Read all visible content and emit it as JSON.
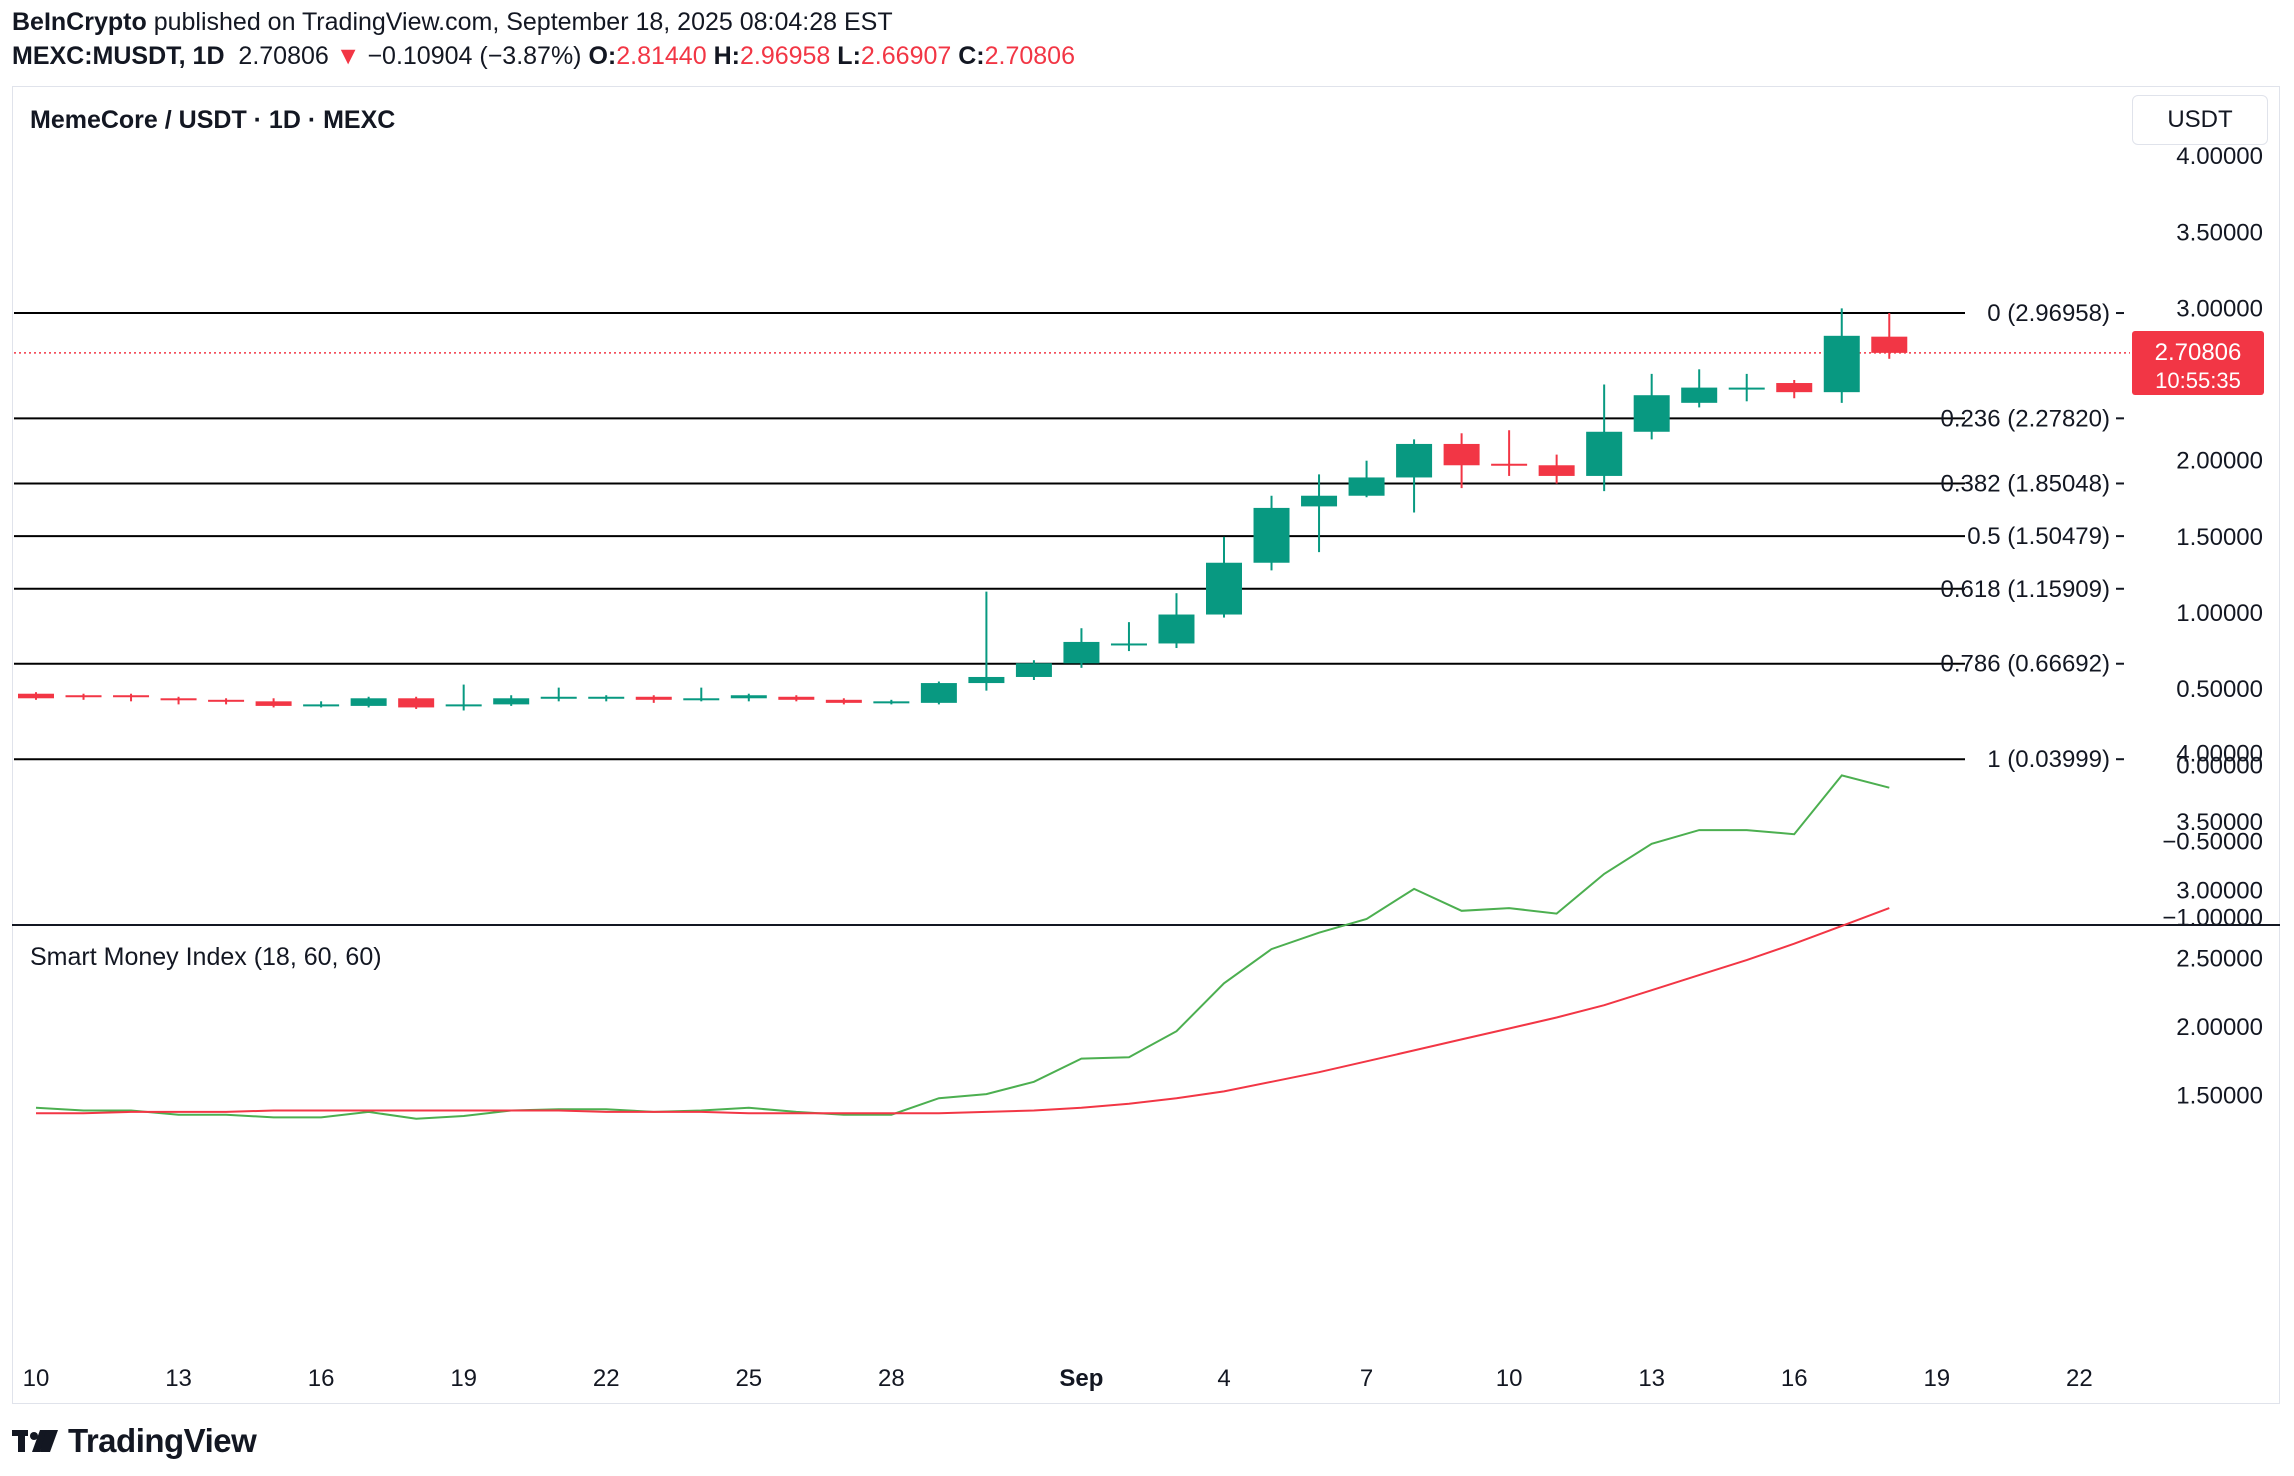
{
  "header": {
    "publisher": "BeInCrypto",
    "published_text": "published on TradingView.com, September 18, 2025 08:04:28 EST",
    "symbol": "MEXC:MUSDT, 1D",
    "last": "2.70806",
    "change_arrow": "▼",
    "change": "−0.10904 (−3.87%)",
    "o_label": "O:",
    "o": "2.81440",
    "h_label": "H:",
    "h": "2.96958",
    "l_label": "L:",
    "l": "2.66907",
    "c_label": "C:",
    "c": "2.70806"
  },
  "main_title": "MemeCore / USDT · 1D · MEXC",
  "currency_button": "USDT",
  "indicator_title": "Smart Money Index (18, 60, 60)",
  "price_label": {
    "value": "2.70806",
    "countdown": "10:55:35"
  },
  "logo_text": "TradingView",
  "colors": {
    "up": "#089981",
    "down": "#f23645",
    "smi_fast": "#4caf50",
    "smi_slow": "#f23645",
    "fib": "#000000"
  },
  "chart_data": [
    {
      "type": "candlestick",
      "title": "MemeCore / USDT · 1D · MEXC",
      "x_ticks": [
        "10",
        "13",
        "16",
        "19",
        "22",
        "25",
        "28",
        "Sep",
        "4",
        "7",
        "10",
        "13",
        "16",
        "19",
        "22"
      ],
      "y_ticks": [
        "4.00000",
        "3.50000",
        "3.00000",
        "2.00000",
        "1.50000",
        "1.00000",
        "0.50000",
        "0.00000",
        "−0.50000",
        "−1.00000"
      ],
      "ylim": [
        -1.0,
        4.0
      ],
      "fib_levels": [
        {
          "ratio": "0",
          "value": 2.96958,
          "label": "0 (2.96958)"
        },
        {
          "ratio": "0.236",
          "value": 2.2782,
          "label": "0.236 (2.27820)"
        },
        {
          "ratio": "0.382",
          "value": 1.85048,
          "label": "0.382 (1.85048)"
        },
        {
          "ratio": "0.5",
          "value": 1.50479,
          "label": "0.5 (1.50479)"
        },
        {
          "ratio": "0.618",
          "value": 1.15909,
          "label": "0.618 (1.15909)"
        },
        {
          "ratio": "0.786",
          "value": 0.66692,
          "label": "0.786 (0.66692)"
        },
        {
          "ratio": "1",
          "value": 0.03999,
          "label": "1 (0.03999)"
        }
      ],
      "candles": [
        {
          "date": "Aug 10",
          "o": 0.47,
          "h": 0.48,
          "l": 0.43,
          "c": 0.44
        },
        {
          "date": "Aug 11",
          "o": 0.46,
          "h": 0.47,
          "l": 0.43,
          "c": 0.45
        },
        {
          "date": "Aug 12",
          "o": 0.46,
          "h": 0.47,
          "l": 0.42,
          "c": 0.45
        },
        {
          "date": "Aug 13",
          "o": 0.44,
          "h": 0.45,
          "l": 0.4,
          "c": 0.43
        },
        {
          "date": "Aug 14",
          "o": 0.43,
          "h": 0.44,
          "l": 0.4,
          "c": 0.42
        },
        {
          "date": "Aug 15",
          "o": 0.42,
          "h": 0.44,
          "l": 0.38,
          "c": 0.39
        },
        {
          "date": "Aug 16",
          "o": 0.39,
          "h": 0.42,
          "l": 0.38,
          "c": 0.4
        },
        {
          "date": "Aug 17",
          "o": 0.39,
          "h": 0.45,
          "l": 0.38,
          "c": 0.44
        },
        {
          "date": "Aug 18",
          "o": 0.44,
          "h": 0.45,
          "l": 0.37,
          "c": 0.38
        },
        {
          "date": "Aug 19",
          "o": 0.39,
          "h": 0.53,
          "l": 0.36,
          "c": 0.4
        },
        {
          "date": "Aug 20",
          "o": 0.4,
          "h": 0.46,
          "l": 0.39,
          "c": 0.44
        },
        {
          "date": "Aug 21",
          "o": 0.44,
          "h": 0.51,
          "l": 0.42,
          "c": 0.45
        },
        {
          "date": "Aug 22",
          "o": 0.45,
          "h": 0.46,
          "l": 0.42,
          "c": 0.45
        },
        {
          "date": "Aug 23",
          "o": 0.45,
          "h": 0.46,
          "l": 0.41,
          "c": 0.43
        },
        {
          "date": "Aug 24",
          "o": 0.43,
          "h": 0.51,
          "l": 0.42,
          "c": 0.44
        },
        {
          "date": "Aug 25",
          "o": 0.44,
          "h": 0.47,
          "l": 0.42,
          "c": 0.46
        },
        {
          "date": "Aug 26",
          "o": 0.45,
          "h": 0.46,
          "l": 0.42,
          "c": 0.43
        },
        {
          "date": "Aug 27",
          "o": 0.43,
          "h": 0.44,
          "l": 0.4,
          "c": 0.41
        },
        {
          "date": "Aug 28",
          "o": 0.41,
          "h": 0.43,
          "l": 0.4,
          "c": 0.42
        },
        {
          "date": "Aug 29",
          "o": 0.41,
          "h": 0.55,
          "l": 0.4,
          "c": 0.54
        },
        {
          "date": "Aug 30",
          "o": 0.54,
          "h": 1.14,
          "l": 0.49,
          "c": 0.58
        },
        {
          "date": "Aug 31",
          "o": 0.58,
          "h": 0.69,
          "l": 0.56,
          "c": 0.67
        },
        {
          "date": "Sep 1",
          "o": 0.67,
          "h": 0.9,
          "l": 0.64,
          "c": 0.81
        },
        {
          "date": "Sep 2",
          "o": 0.79,
          "h": 0.94,
          "l": 0.75,
          "c": 0.8
        },
        {
          "date": "Sep 3",
          "o": 0.8,
          "h": 1.13,
          "l": 0.77,
          "c": 0.99
        },
        {
          "date": "Sep 4",
          "o": 0.99,
          "h": 1.5,
          "l": 0.97,
          "c": 1.33
        },
        {
          "date": "Sep 5",
          "o": 1.33,
          "h": 1.77,
          "l": 1.28,
          "c": 1.69
        },
        {
          "date": "Sep 6",
          "o": 1.7,
          "h": 1.91,
          "l": 1.4,
          "c": 1.77
        },
        {
          "date": "Sep 7",
          "o": 1.77,
          "h": 2.0,
          "l": 1.76,
          "c": 1.89
        },
        {
          "date": "Sep 8",
          "o": 1.89,
          "h": 2.14,
          "l": 1.66,
          "c": 2.11
        },
        {
          "date": "Sep 9",
          "o": 2.11,
          "h": 2.18,
          "l": 1.82,
          "c": 1.97
        },
        {
          "date": "Sep 10",
          "o": 1.98,
          "h": 2.2,
          "l": 1.9,
          "c": 1.97
        },
        {
          "date": "Sep 11",
          "o": 1.97,
          "h": 2.04,
          "l": 1.85,
          "c": 1.9
        },
        {
          "date": "Sep 12",
          "o": 1.9,
          "h": 2.5,
          "l": 1.8,
          "c": 2.19
        },
        {
          "date": "Sep 13",
          "o": 2.19,
          "h": 2.57,
          "l": 2.14,
          "c": 2.43
        },
        {
          "date": "Sep 14",
          "o": 2.38,
          "h": 2.6,
          "l": 2.35,
          "c": 2.48
        },
        {
          "date": "Sep 15",
          "o": 2.48,
          "h": 2.57,
          "l": 2.39,
          "c": 2.48
        },
        {
          "date": "Sep 16",
          "o": 2.51,
          "h": 2.53,
          "l": 2.41,
          "c": 2.45
        },
        {
          "date": "Sep 17",
          "o": 2.45,
          "h": 3.0,
          "l": 2.38,
          "c": 2.82
        },
        {
          "date": "Sep 18",
          "o": 2.8144,
          "h": 2.96958,
          "l": 2.66907,
          "c": 2.70806
        }
      ]
    },
    {
      "type": "line",
      "title": "Smart Money Index (18, 60, 60)",
      "y_ticks": [
        "4.00000",
        "3.50000",
        "3.00000",
        "2.50000",
        "2.00000",
        "1.50000"
      ],
      "ylim": [
        1.25,
        4.0
      ],
      "x": [
        "Aug 10",
        "Aug 11",
        "Aug 12",
        "Aug 13",
        "Aug 14",
        "Aug 15",
        "Aug 16",
        "Aug 17",
        "Aug 18",
        "Aug 19",
        "Aug 20",
        "Aug 21",
        "Aug 22",
        "Aug 23",
        "Aug 24",
        "Aug 25",
        "Aug 26",
        "Aug 27",
        "Aug 28",
        "Aug 29",
        "Aug 30",
        "Aug 31",
        "Sep 1",
        "Sep 2",
        "Sep 3",
        "Sep 4",
        "Sep 5",
        "Sep 6",
        "Sep 7",
        "Sep 8",
        "Sep 9",
        "Sep 10",
        "Sep 11",
        "Sep 12",
        "Sep 13",
        "Sep 14",
        "Sep 15",
        "Sep 16",
        "Sep 17",
        "Sep 18"
      ],
      "series": [
        {
          "values": [
            1.41,
            1.39,
            1.39,
            1.36,
            1.36,
            1.34,
            1.34,
            1.38,
            1.33,
            1.35,
            1.39,
            1.4,
            1.4,
            1.38,
            1.39,
            1.41,
            1.38,
            1.36,
            1.36,
            1.48,
            1.51,
            1.6,
            1.77,
            1.78,
            1.97,
            2.32,
            2.57,
            2.69,
            2.79,
            3.01,
            2.85,
            2.87,
            2.83,
            3.12,
            3.34,
            3.44,
            3.44,
            3.41,
            3.84,
            3.75
          ]
        },
        {
          "values": [
            1.37,
            1.37,
            1.38,
            1.38,
            1.38,
            1.39,
            1.39,
            1.39,
            1.39,
            1.39,
            1.39,
            1.39,
            1.38,
            1.38,
            1.38,
            1.37,
            1.37,
            1.37,
            1.37,
            1.37,
            1.38,
            1.39,
            1.41,
            1.44,
            1.48,
            1.53,
            1.6,
            1.67,
            1.75,
            1.83,
            1.91,
            1.99,
            2.07,
            2.16,
            2.27,
            2.38,
            2.49,
            2.61,
            2.74,
            2.87
          ]
        }
      ]
    }
  ]
}
